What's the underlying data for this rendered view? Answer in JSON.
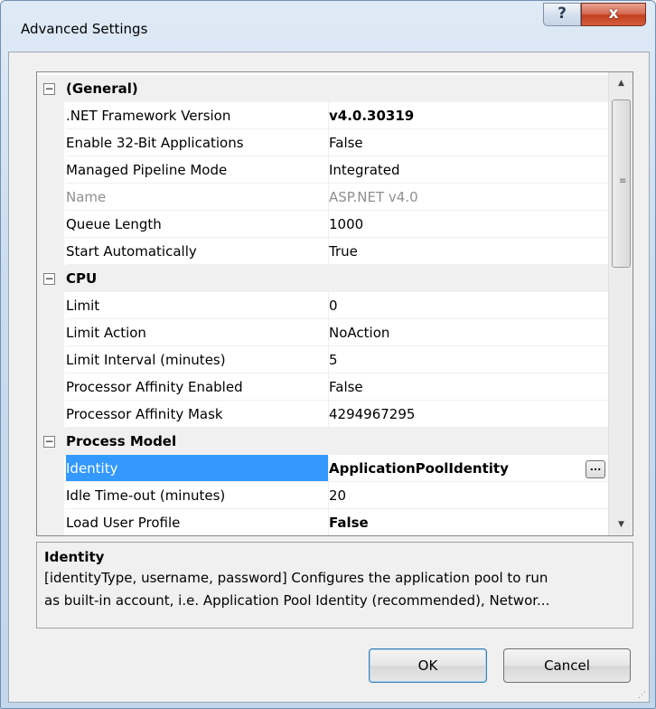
{
  "window": {
    "title": "Advanced Settings",
    "help_label": "?",
    "close_label": "x"
  },
  "grid": {
    "categories": [
      {
        "label": "(General)",
        "toggle": "−",
        "rows": [
          {
            "name": ".NET Framework Version",
            "value": "v4.0.30319",
            "bold": true
          },
          {
            "name": "Enable 32-Bit Applications",
            "value": "False"
          },
          {
            "name": "Managed Pipeline Mode",
            "value": "Integrated"
          },
          {
            "name": "Name",
            "value": "ASP.NET v4.0",
            "disabled": true
          },
          {
            "name": "Queue Length",
            "value": "1000"
          },
          {
            "name": "Start Automatically",
            "value": "True"
          }
        ]
      },
      {
        "label": "CPU",
        "toggle": "−",
        "rows": [
          {
            "name": "Limit",
            "value": "0"
          },
          {
            "name": "Limit Action",
            "value": "NoAction"
          },
          {
            "name": "Limit Interval (minutes)",
            "value": "5"
          },
          {
            "name": "Processor Affinity Enabled",
            "value": "False"
          },
          {
            "name": "Processor Affinity Mask",
            "value": "4294967295"
          }
        ]
      },
      {
        "label": "Process Model",
        "toggle": "−",
        "rows": [
          {
            "name": "Identity",
            "value": "ApplicationPoolIdentity",
            "bold": true,
            "selected": true,
            "button": "..."
          },
          {
            "name": "Idle Time-out (minutes)",
            "value": "20"
          },
          {
            "name": "Load User Profile",
            "value": "False",
            "bold": true
          }
        ]
      }
    ],
    "scroll_up": "▲",
    "scroll_down": "▼",
    "scroll_grip": "≡"
  },
  "description": {
    "title": "Identity",
    "line1": "[identityType, username, password] Configures the application pool to run",
    "line2": "as built-in account, i.e. Application Pool Identity (recommended), Networ..."
  },
  "buttons": {
    "ok": "OK",
    "cancel": "Cancel"
  },
  "colors": {
    "selection": "#3399ff",
    "gutter": "#f0f0f0",
    "close": "#c4401f"
  }
}
